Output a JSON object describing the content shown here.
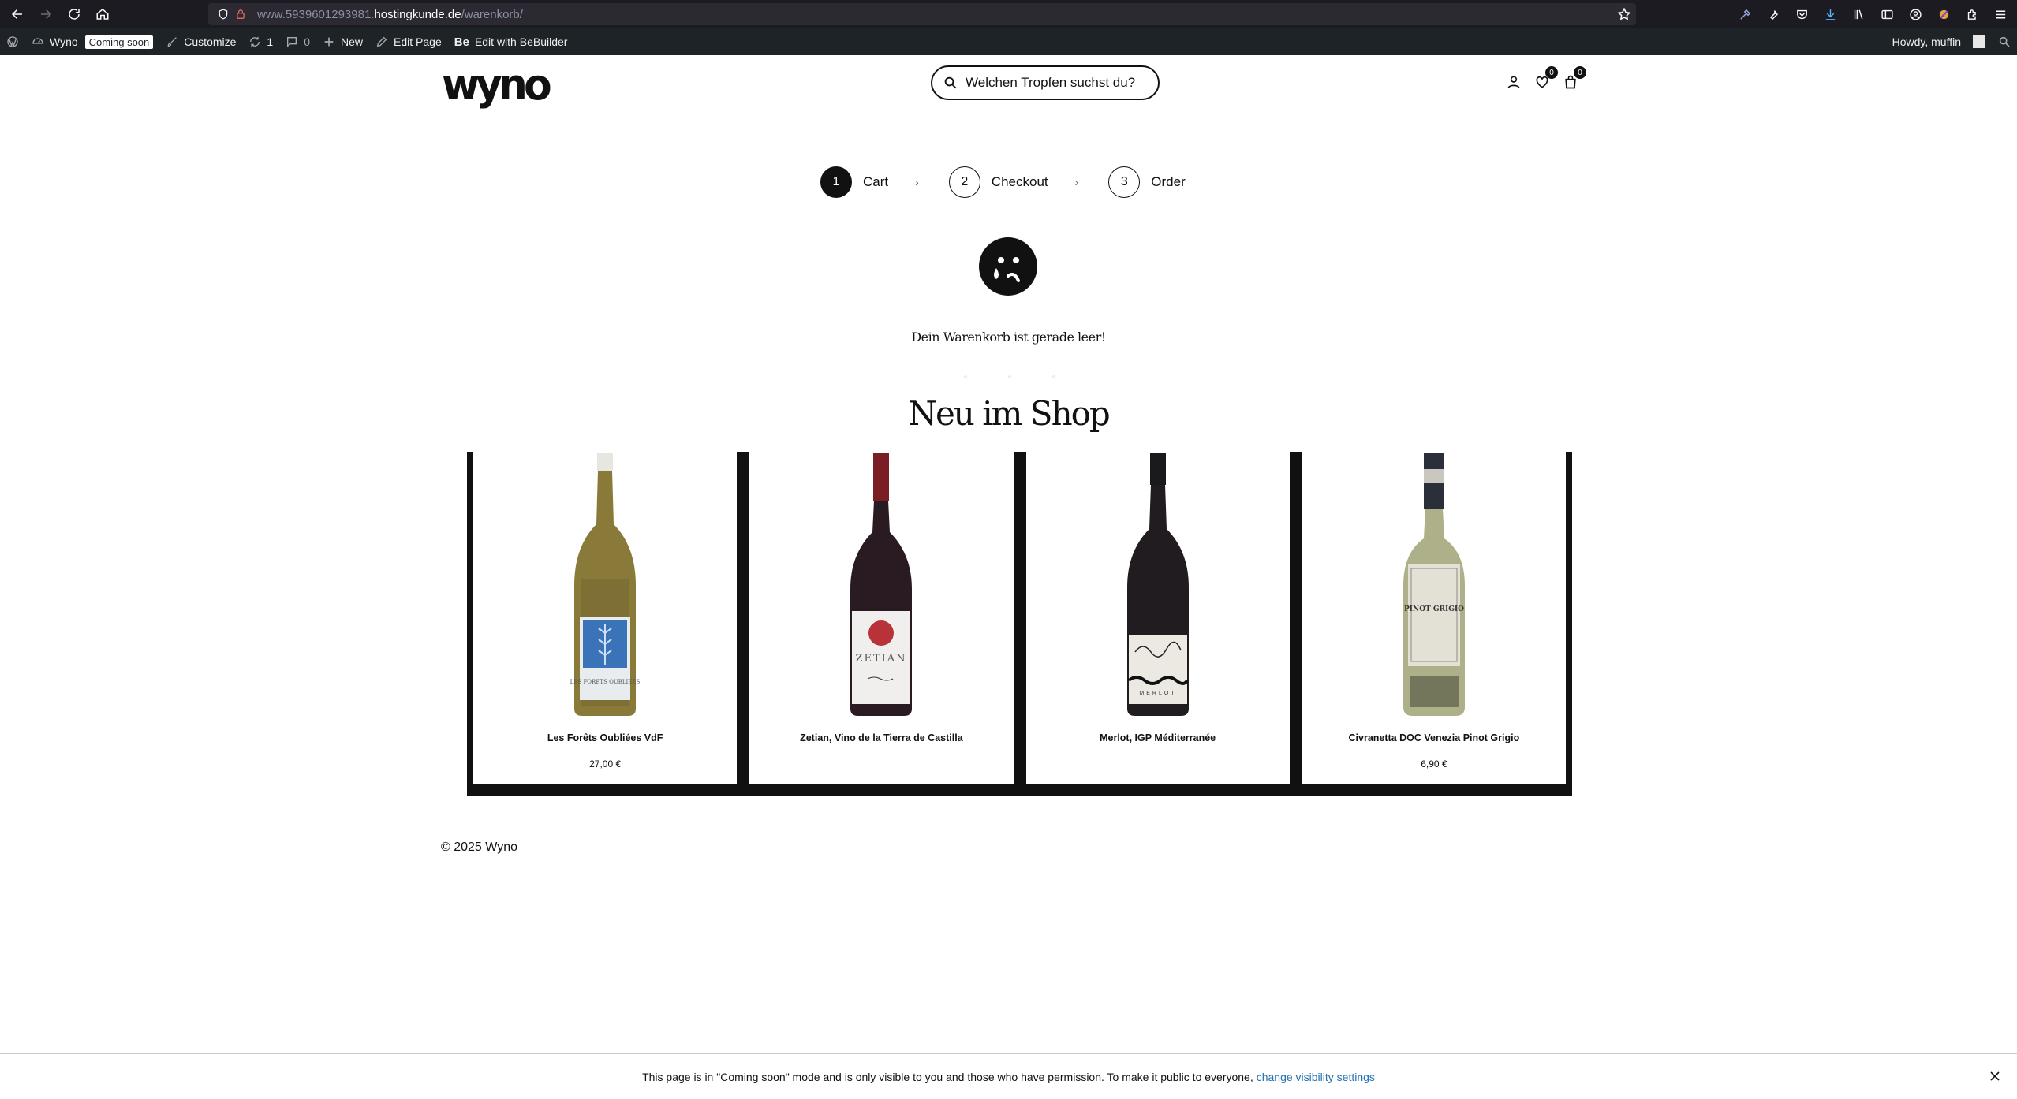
{
  "browser": {
    "url_prefix": "www.5939601293981.",
    "url_host": "hostingkunde.de",
    "url_path": "/warenkorb/"
  },
  "wp_bar": {
    "site_name": "Wyno",
    "badge": "Coming soon",
    "customize": "Customize",
    "updates_count": "1",
    "comments_count": "0",
    "new": "New",
    "edit_page": "Edit Page",
    "edit_builder": "Edit with BeBuilder",
    "builder_prefix": "Be",
    "howdy": "Howdy, muffin"
  },
  "header": {
    "logo": "wyno",
    "search_placeholder": "Welchen Tropfen suchst du?",
    "wishlist_count": "0",
    "cart_count": "0"
  },
  "steps": [
    {
      "num": "1",
      "label": "Cart"
    },
    {
      "num": "2",
      "label": "Checkout"
    },
    {
      "num": "3",
      "label": "Order"
    }
  ],
  "step_separator": "›",
  "cart": {
    "empty_message": "Dein Warenkorb ist gerade leer!"
  },
  "new_in_shop": {
    "heading": "Neu im Shop",
    "products": [
      {
        "name": "Les Forêts Oubliées VdF",
        "price": "27,00 €",
        "label_text": "LES FORETS OUBLIEES"
      },
      {
        "name": "Zetian, Vino de la Tierra de Castilla",
        "price": "",
        "label_text": "ZETIAN"
      },
      {
        "name": "Merlot, IGP Méditerranée",
        "price": "",
        "label_text": "MERLOT"
      },
      {
        "name": "Civranetta DOC Venezia Pinot Grigio",
        "price": "6,90 €",
        "label_text": "PINOT GRIGIO"
      }
    ]
  },
  "footer": {
    "copyright": "© 2025 Wyno"
  },
  "notice": {
    "text": "This page is in \"Coming soon\" mode and is only visible to you and those who have permission. To make it public to everyone,",
    "link": "change visibility settings"
  },
  "colors": {
    "browser_bg": "#1c1b22",
    "wp_bar_bg": "#1d2327",
    "link": "#2271b1"
  }
}
